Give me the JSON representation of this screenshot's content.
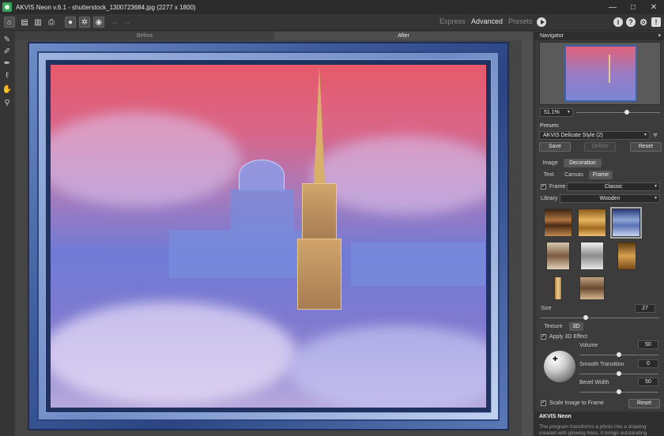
{
  "window": {
    "title": "AKVIS Neon v.6.1 - shutterstock_1300723684.jpg (2277 x 1800)",
    "controls": [
      "—",
      "□",
      "✕"
    ]
  },
  "toolbar": {
    "modes": [
      "Express",
      "Advanced",
      "Presets"
    ],
    "active_mode": "Advanced"
  },
  "canvas": {
    "tab_before": "Before",
    "tab_after": "After"
  },
  "navigator": {
    "title": "Navigator",
    "zoom": "51.1%",
    "zoom_fraction": 0.6
  },
  "presets": {
    "title": "Presets",
    "selected": "AKVIS Delicate Style (2)",
    "save": "Save",
    "delete": "Delete",
    "reset": "Reset"
  },
  "tabs": {
    "main": [
      "Image",
      "Decoration"
    ],
    "active_main": "Decoration",
    "sub": [
      "Text",
      "Canvas",
      "Frame"
    ],
    "active_sub": "Frame"
  },
  "frame": {
    "frame_label": "Frame",
    "frame_checked": true,
    "frame_type": "Classic",
    "library_label": "Library",
    "library": "Wooden",
    "size_label": "Size",
    "size": "27",
    "size_fraction": 0.38
  },
  "texture": {
    "tabs": [
      "Texture",
      "3D"
    ],
    "active": "3D",
    "apply_3d_label": "Apply 3D Effect",
    "apply_3d": true,
    "volume_label": "Volume",
    "volume": "50",
    "smooth_label": "Smooth Transition",
    "smooth": "0",
    "bevel_label": "Bevel Width",
    "bevel": "50",
    "scale_label": "Scale Image to Frame",
    "scale": true,
    "reset": "Reset"
  },
  "info": {
    "title": "AKVIS Neon",
    "text": "The program transforms a photo into a drawing created with glowing lines. It brings outstanding"
  },
  "colors": {
    "frame_blue": "#3d5a9a",
    "sky_pink": "#e65a6a",
    "sky_violet": "#7f7ad0"
  }
}
